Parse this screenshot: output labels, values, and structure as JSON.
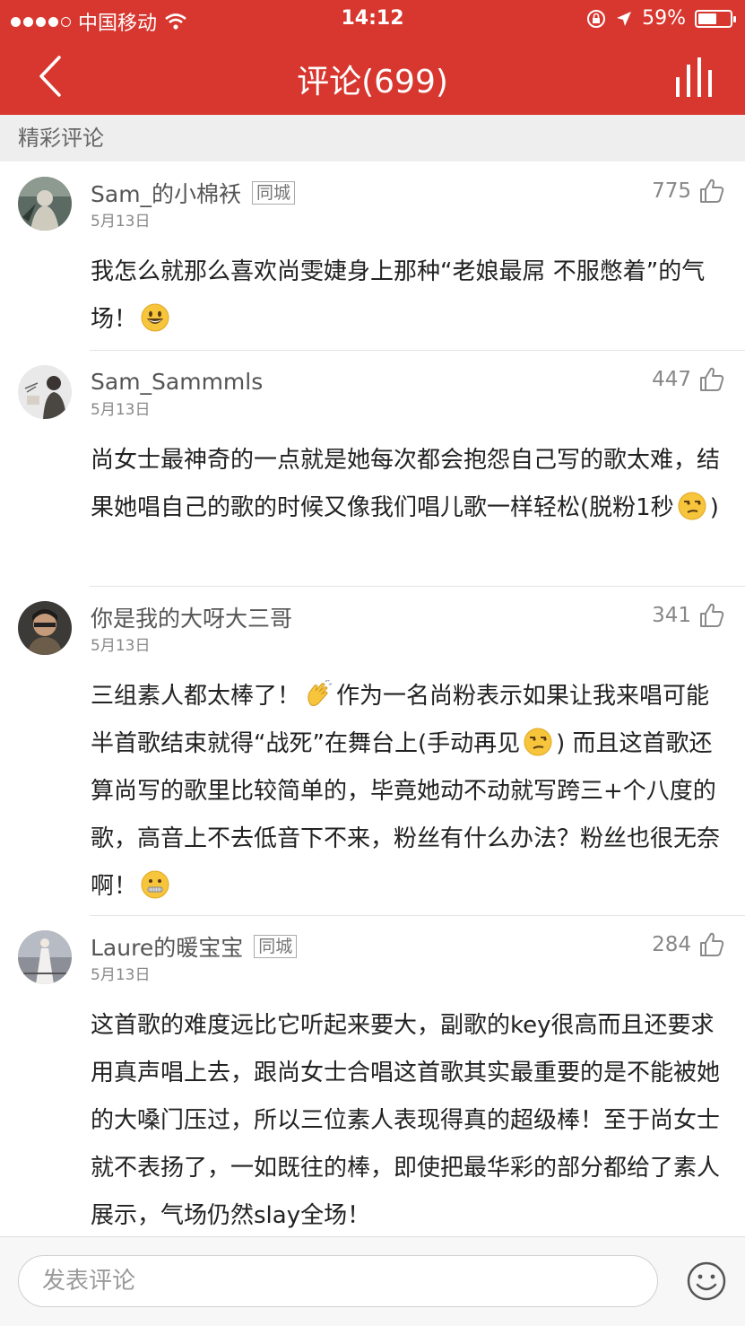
{
  "statusbar": {
    "carrier": "中国移动",
    "time": "14:12",
    "battery_text": "59%",
    "battery_level": 0.59
  },
  "nav": {
    "title": "评论(699)"
  },
  "section": {
    "title": "精彩评论"
  },
  "comments": [
    {
      "username": "Sam_的小棉袄",
      "tag": "同城",
      "date": "5月13日",
      "likes": "775",
      "text_parts": [
        "我怎么就那么喜欢尚雯婕身上那种“老娘最屌  不服憋着”的气场！"
      ],
      "emojis": [
        "smile-emoji"
      ]
    },
    {
      "username": "Sam_Sammmls",
      "tag": "",
      "date": "5月13日",
      "likes": "447",
      "text_parts": [
        "尚女士最神奇的一点就是她每次都会抱怨自己写的歌太难，结果她唱自己的歌的时候又像我们唱儿歌一样轻松(脱粉1秒",
        ")"
      ],
      "emojis": [
        "unamused-emoji"
      ]
    },
    {
      "username": "你是我的大呀大三哥",
      "tag": "",
      "date": "5月13日",
      "likes": "341",
      "text_parts": [
        "三组素人都太棒了！",
        "作为一名尚粉表示如果让我来唱可能半首歌结束就得“战死”在舞台上(手动再见",
        ") 而且这首歌还算尚写的歌里比较简单的，毕竟她动不动就写跨三+个八度的歌，高音上不去低音下不来，粉丝有什么办法？粉丝也很无奈啊！"
      ],
      "emojis": [
        "clap-emoji",
        "unamused-emoji",
        "zipper-mouth-emoji"
      ]
    },
    {
      "username": "Laure的暖宝宝",
      "tag": "同城",
      "date": "5月13日",
      "likes": "284",
      "text_parts": [
        "这首歌的难度远比它听起来要大，副歌的key很高而且还要求用真声唱上去，跟尚女士合唱这首歌其实最重要的是不能被她的大嗓门压过，所以三位素人表现得真的超级棒！至于尚女士就不表扬了，一如既往的棒，即使把最华彩的部分都给了素人展示，气场仍然slay全场！"
      ],
      "emojis": []
    }
  ],
  "input": {
    "placeholder": "发表评论"
  },
  "colors": {
    "brand_red": "#d7372f",
    "section_bg": "#eeeeee"
  }
}
